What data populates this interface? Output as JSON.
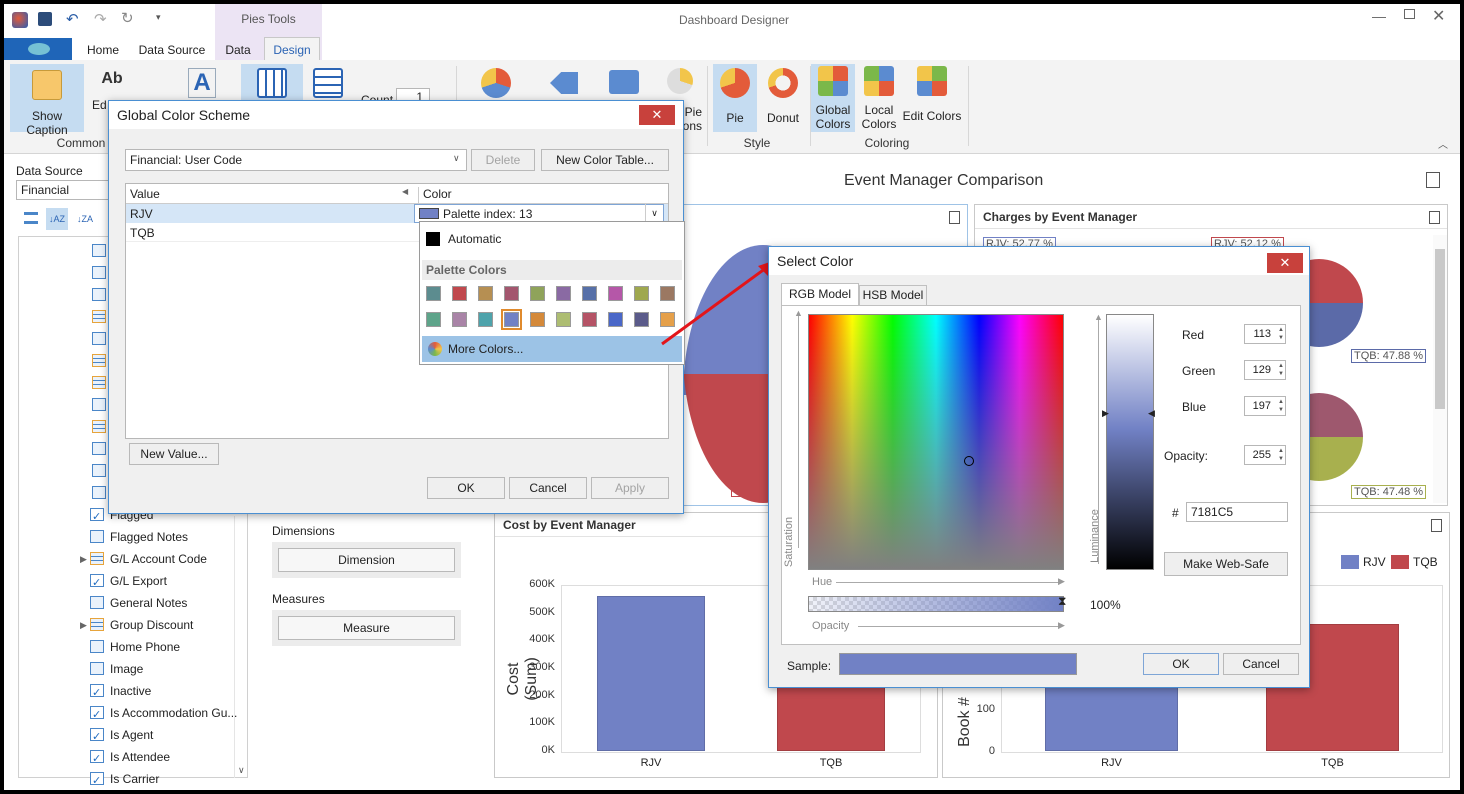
{
  "app": {
    "title": "Dashboard Designer",
    "context_tab": "Pies Tools"
  },
  "tabs": [
    {
      "label": "Home"
    },
    {
      "label": "Data Source"
    },
    {
      "label": "Data"
    },
    {
      "label": "Design"
    }
  ],
  "ribbon": {
    "show_caption": "Show Caption",
    "edit_partial": "Ed",
    "count_label": "Count",
    "count_value": "1",
    "pie_label_partial": "Pie",
    "options_partial": "ons",
    "pie": "Pie",
    "donut": "Donut",
    "global_colors_1": "Global",
    "global_colors_2": "Colors",
    "local_colors_1": "Local",
    "local_colors_2": "Colors",
    "edit_colors": "Edit Colors",
    "groups": {
      "common": "Common",
      "style": "Style",
      "coloring": "Coloring"
    }
  },
  "datasource": {
    "label": "Data Source",
    "value": "Financial",
    "fields": [
      {
        "name": "Flagged",
        "kind": "check"
      },
      {
        "name": "Flagged Notes",
        "kind": "text"
      },
      {
        "name": "G/L Account Code",
        "kind": "table",
        "expand": true
      },
      {
        "name": "G/L Export",
        "kind": "check"
      },
      {
        "name": "General Notes",
        "kind": "text"
      },
      {
        "name": "Group Discount",
        "kind": "table",
        "expand": true
      },
      {
        "name": "Home Phone",
        "kind": "text"
      },
      {
        "name": "Image",
        "kind": "num"
      },
      {
        "name": "Inactive",
        "kind": "check"
      },
      {
        "name": "Is Accommodation Gu...",
        "kind": "check"
      },
      {
        "name": "Is Agent",
        "kind": "check"
      },
      {
        "name": "Is Attendee",
        "kind": "check"
      },
      {
        "name": "Is Carrier",
        "kind": "check"
      }
    ]
  },
  "binding": {
    "dimensions_label": "Dimensions",
    "dimension_btn": "Dimension",
    "measures_label": "Measures",
    "measure_btn": "Measure"
  },
  "dashboard": {
    "title": "Event Manager Comparison",
    "charges_title": "Charges by Event Manager",
    "cost_title": "Cost by Event Manager",
    "pie_labels": {
      "rjv": "RJV: 52.77 %",
      "tqb_right": "RJV: 52.12 %",
      "tqb1": "TQB: 47.88 %",
      "tqb2": "TQB: 47.48 %"
    },
    "legend": [
      "RJV",
      "TQB"
    ],
    "ylabel_left": "Cost (Sum)",
    "ylabel_right": "Book #",
    "right_ticks": [
      "100",
      "0"
    ]
  },
  "chart_data": [
    {
      "type": "bar",
      "title": "Cost by Event Manager",
      "categories": [
        "RJV",
        "TQB"
      ],
      "values": [
        560000,
        380000
      ],
      "ylabel": "Cost (Sum)",
      "ylim": [
        0,
        600000
      ],
      "yticks": [
        "600K",
        "500K",
        "400K",
        "300K",
        "200K",
        "100K",
        "0K"
      ],
      "colors": [
        "#7181c5",
        "#c0484d"
      ]
    },
    {
      "type": "bar",
      "categories": [
        "RJV",
        "TQB"
      ],
      "values": [
        150,
        230
      ],
      "ylabel": "Book #",
      "colors": [
        "#7181c5",
        "#c0484d"
      ]
    }
  ],
  "global_scheme": {
    "title": "Global Color Scheme",
    "table_select": "Financial: User Code",
    "delete": "Delete",
    "new_color_table": "New Color Table...",
    "col_value": "Value",
    "col_color": "Color",
    "rows": [
      {
        "value": "RJV",
        "color": "Palette index: 13"
      },
      {
        "value": "TQB",
        "color": ""
      }
    ],
    "new_value": "New Value...",
    "ok": "OK",
    "cancel": "Cancel",
    "apply": "Apply",
    "dropdown": {
      "automatic": "Automatic",
      "palette_header": "Palette Colors",
      "more": "More Colors...",
      "palette": [
        "#5c8c8f",
        "#c0484d",
        "#b68f52",
        "#a3566e",
        "#8fa35a",
        "#8a6aa3",
        "#5770a8",
        "#b557a8",
        "#9fa84e",
        "#9b7862",
        "#5ea48a",
        "#a984a7",
        "#4ea3ab",
        "#7181c5",
        "#d4893a",
        "#adbd72",
        "#b55466",
        "#4a67c8",
        "#5b5b8a",
        "#e5a04a"
      ]
    }
  },
  "select_color": {
    "title": "Select Color",
    "tabs": [
      "RGB Model",
      "HSB Model"
    ],
    "red_label": "Red",
    "red": "113",
    "green_label": "Green",
    "green": "129",
    "blue_label": "Blue",
    "blue": "197",
    "opacity_label": "Opacity:",
    "opacity": "255",
    "hash": "#",
    "hex": "7181C5",
    "web_safe": "Make Web-Safe",
    "saturation": "Saturation",
    "hue": "Hue",
    "opacity_axis": "Opacity",
    "luminance": "Luminance",
    "percent": "100%",
    "sample_label": "Sample:",
    "ok": "OK",
    "cancel": "Cancel",
    "sample_color": "#7181c5"
  }
}
